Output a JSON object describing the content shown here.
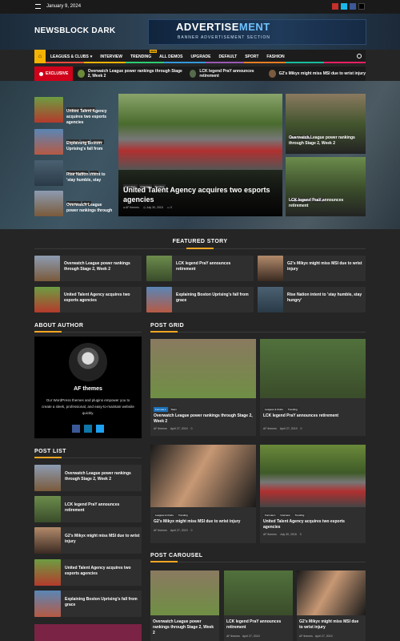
{
  "topbar": {
    "date": "January 9, 2024",
    "social": [
      "youtube-icon",
      "vimeo-icon",
      "facebook-icon",
      "x-icon"
    ]
  },
  "site": {
    "title": "NEWSBLOCK DARK"
  },
  "ad": {
    "title_a": "ADVERTISE",
    "title_b": "MENT",
    "subtitle": "BANNER ADVERTISEMENT SECTION"
  },
  "nav": {
    "items": [
      "LEAGUES & CLUBS",
      "INTERVIEW",
      "TRENDING",
      "ALL DEMOS",
      "UPGRADE",
      "DEFAULT",
      "SPORT",
      "FASHION"
    ],
    "new_badge": "NEW"
  },
  "ticker": {
    "label": "EXCLUSIVE",
    "items": [
      "Overwatch League power rankings through Stage 2, Week 2",
      "LCK legend PraY announces retirement",
      "G2's Mikyx might miss MSI due to wrist injury"
    ]
  },
  "hero": {
    "left": [
      {
        "badges": [
          "Formula 1",
          "Interview"
        ],
        "title": "United Talent Agency acquires two esports agencies"
      },
      {
        "badges": [
          "Interview",
          "Team",
          "Trending"
        ],
        "title": "Explaining Boston Uprising's fall from"
      },
      {
        "badges": [
          "Leagues & Clubs",
          "Team"
        ],
        "title": "Rise Nation intent to 'stay humble, stay"
      },
      {
        "badges": [
          "Formula 1",
          "Team"
        ],
        "title": "Overwatch League power rankings through"
      }
    ],
    "main": {
      "badges": [
        "Formula 1",
        "Interview",
        "Trending"
      ],
      "title": "United Talent Agency acquires two esports agencies",
      "author": "AF themes",
      "date": "July 30, 2018",
      "comments": "0"
    },
    "right": [
      {
        "badges": [
          "Team",
          "Trending"
        ],
        "title": "Overwatch League power rankings through Stage 2, Week 2"
      },
      {
        "badges": [
          "Leagues & Clubs",
          "Trending"
        ],
        "title": "LCK legend PraY announces retirement"
      }
    ]
  },
  "featured": {
    "title": "FEATURED STORY",
    "items": [
      "Overwatch League power rankings through Stage 2, Week 2",
      "LCK legend PraY announces retirement",
      "G2's Mikyx might miss MSI due to wrist injury",
      "United Talent Agency acquires two esports agencies",
      "Explaining Boston Uprising's fall from grace",
      "Rise Nation intent to 'stay humble, stay hungry'"
    ]
  },
  "about": {
    "title": "ABOUT AUTHOR",
    "name": "AF themes",
    "text": "Our WordPress themes and plugins empower you to create a sleek, professional, and easy-to-maintain website quickly."
  },
  "post_list": {
    "title": "POST LIST",
    "items": [
      "Overwatch League power rankings through Stage 2, Week 2",
      "LCK legend PraY announces retirement",
      "G2's Mikyx might miss MSI due to wrist injury",
      "United Talent Agency acquires two esports agencies",
      "Explaining Boston Uprising's fall from grace"
    ]
  },
  "post_grid": {
    "title": "POST GRID",
    "items": [
      {
        "badges": [
          "Formula 1",
          "Team"
        ],
        "title": "Overwatch League power rankings through Stage 2, Week 2",
        "author": "AF themes",
        "date": "April 27, 2019",
        "comments": "0"
      },
      {
        "badges": [
          "Leagues & Clubs",
          "Trending"
        ],
        "title": "LCK legend PraY announces retirement",
        "author": "AF themes",
        "date": "April 27, 2019",
        "comments": "0"
      },
      {
        "badges": [
          "Leagues & Clubs",
          "Trending"
        ],
        "title": "G2's Mikyx might miss MSI due to wrist injury",
        "author": "AF themes",
        "date": "April 27, 2019",
        "comments": "0"
      },
      {
        "badges": [
          "Formula 1",
          "Interview",
          "Trending"
        ],
        "title": "United Talent Agency acquires two esports agencies",
        "author": "AF themes",
        "date": "July 30, 2018",
        "comments": "0"
      }
    ]
  },
  "carousel": {
    "title": "POST CAROUSEL",
    "items": [
      {
        "title": "Overwatch League power rankings through Stage 2, Week 2",
        "author": "AF themes",
        "date": "April 27, 2019"
      },
      {
        "title": "LCK legend PraY announces retirement",
        "author": "AF themes",
        "date": "April 27, 2019"
      },
      {
        "title": "G2's Mikyx might miss MSI due to wrist injury",
        "author": "AF themes",
        "date": "April 27, 2019"
      }
    ]
  }
}
